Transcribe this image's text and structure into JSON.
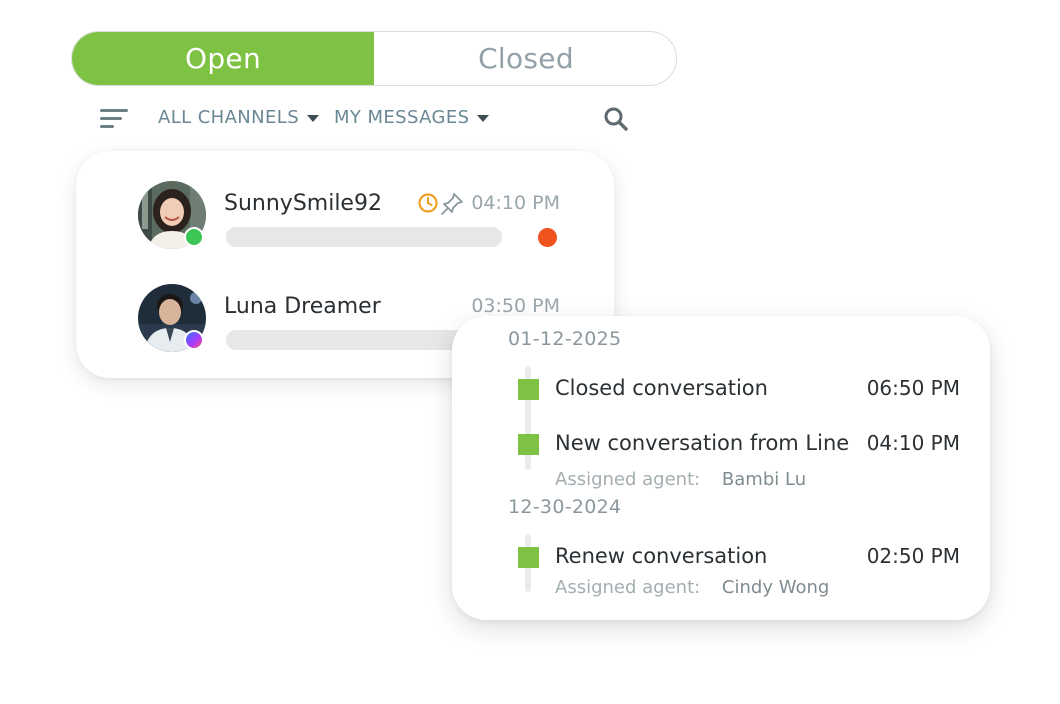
{
  "tabs": {
    "open_label": "Open",
    "closed_label": "Closed",
    "active": "Open"
  },
  "filters": {
    "channels_label": "ALL CHANNELS",
    "messages_label": "MY MESSAGES"
  },
  "icons": {
    "filter": "filter-lines-icon",
    "search": "search-icon",
    "dropdown": "caret-down-icon",
    "snooze": "clock-icon",
    "pin": "pin-icon"
  },
  "conversations": [
    {
      "name": "SunnySmile92",
      "time": "04:10 PM",
      "channel": "Line",
      "pinned": true,
      "snoozed": true,
      "unread": true
    },
    {
      "name": "Luna Dreamer",
      "time": "03:50 PM",
      "channel": "Messenger",
      "pinned": false,
      "snoozed": false,
      "unread": false
    }
  ],
  "timeline": {
    "groups": [
      {
        "date": "01-12-2025",
        "events": [
          {
            "label": "Closed conversation",
            "time": "06:50 PM"
          },
          {
            "label": "New conversation from Line",
            "time": "04:10 PM",
            "assigned_label": "Assigned agent:",
            "agent": "Bambi Lu"
          }
        ]
      },
      {
        "date": "12-30-2024",
        "events": [
          {
            "label": "Renew conversation",
            "time": "02:50 PM",
            "assigned_label": "Assigned agent:",
            "agent": "Cindy Wong"
          }
        ]
      }
    ]
  },
  "colors": {
    "accent_green": "#7dc242",
    "unread_red": "#f0541e",
    "snooze_orange": "#f0a020",
    "line_green": "#3cc655"
  }
}
